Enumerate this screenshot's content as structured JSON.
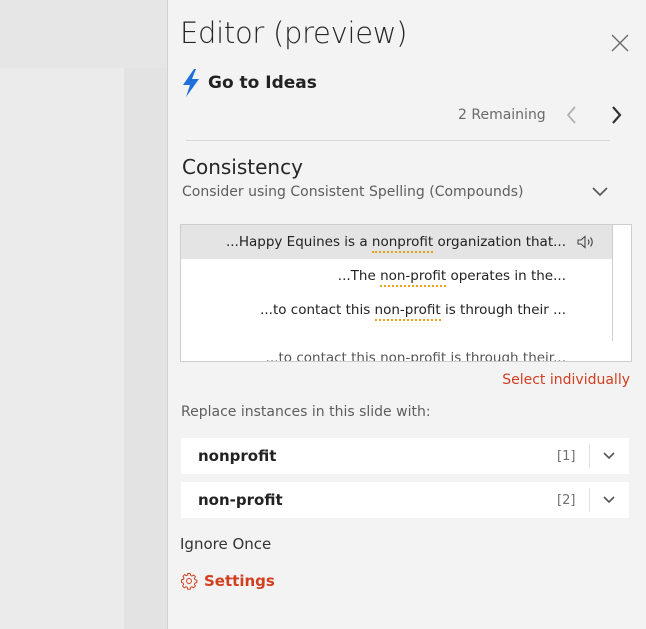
{
  "pane": {
    "title": "Editor (preview)"
  },
  "ideas": {
    "label": "Go to Ideas",
    "icon": "lightning-bolt-icon",
    "accent": "#1e6fd9"
  },
  "nav": {
    "remaining": "2 Remaining"
  },
  "category": {
    "title": "Consistency",
    "subtitle": "Consider using Consistent Spelling (Compounds)"
  },
  "instances": [
    {
      "before": "...Happy Equines is a ",
      "term": "nonprofit",
      "after": " organization that..."
    },
    {
      "before": "...The ",
      "term": "non-profit",
      "after": " operates in the..."
    },
    {
      "before": "...to contact this ",
      "term": "non-profit",
      "after": " is through their ..."
    },
    {
      "before": "...to contact this ",
      "term": "non-profit",
      "after": " is through their..."
    }
  ],
  "select_individually": "Select individually",
  "replace_header": "Replace instances in this slide with:",
  "options": [
    {
      "word": "nonprofit",
      "count": "[1]"
    },
    {
      "word": "non-profit",
      "count": "[2]"
    }
  ],
  "ignore_once": "Ignore Once",
  "settings": {
    "label": "Settings",
    "icon": "gear-icon"
  },
  "colors": {
    "accent_red": "#d13f1f",
    "highlight_underline": "#e8a317"
  }
}
